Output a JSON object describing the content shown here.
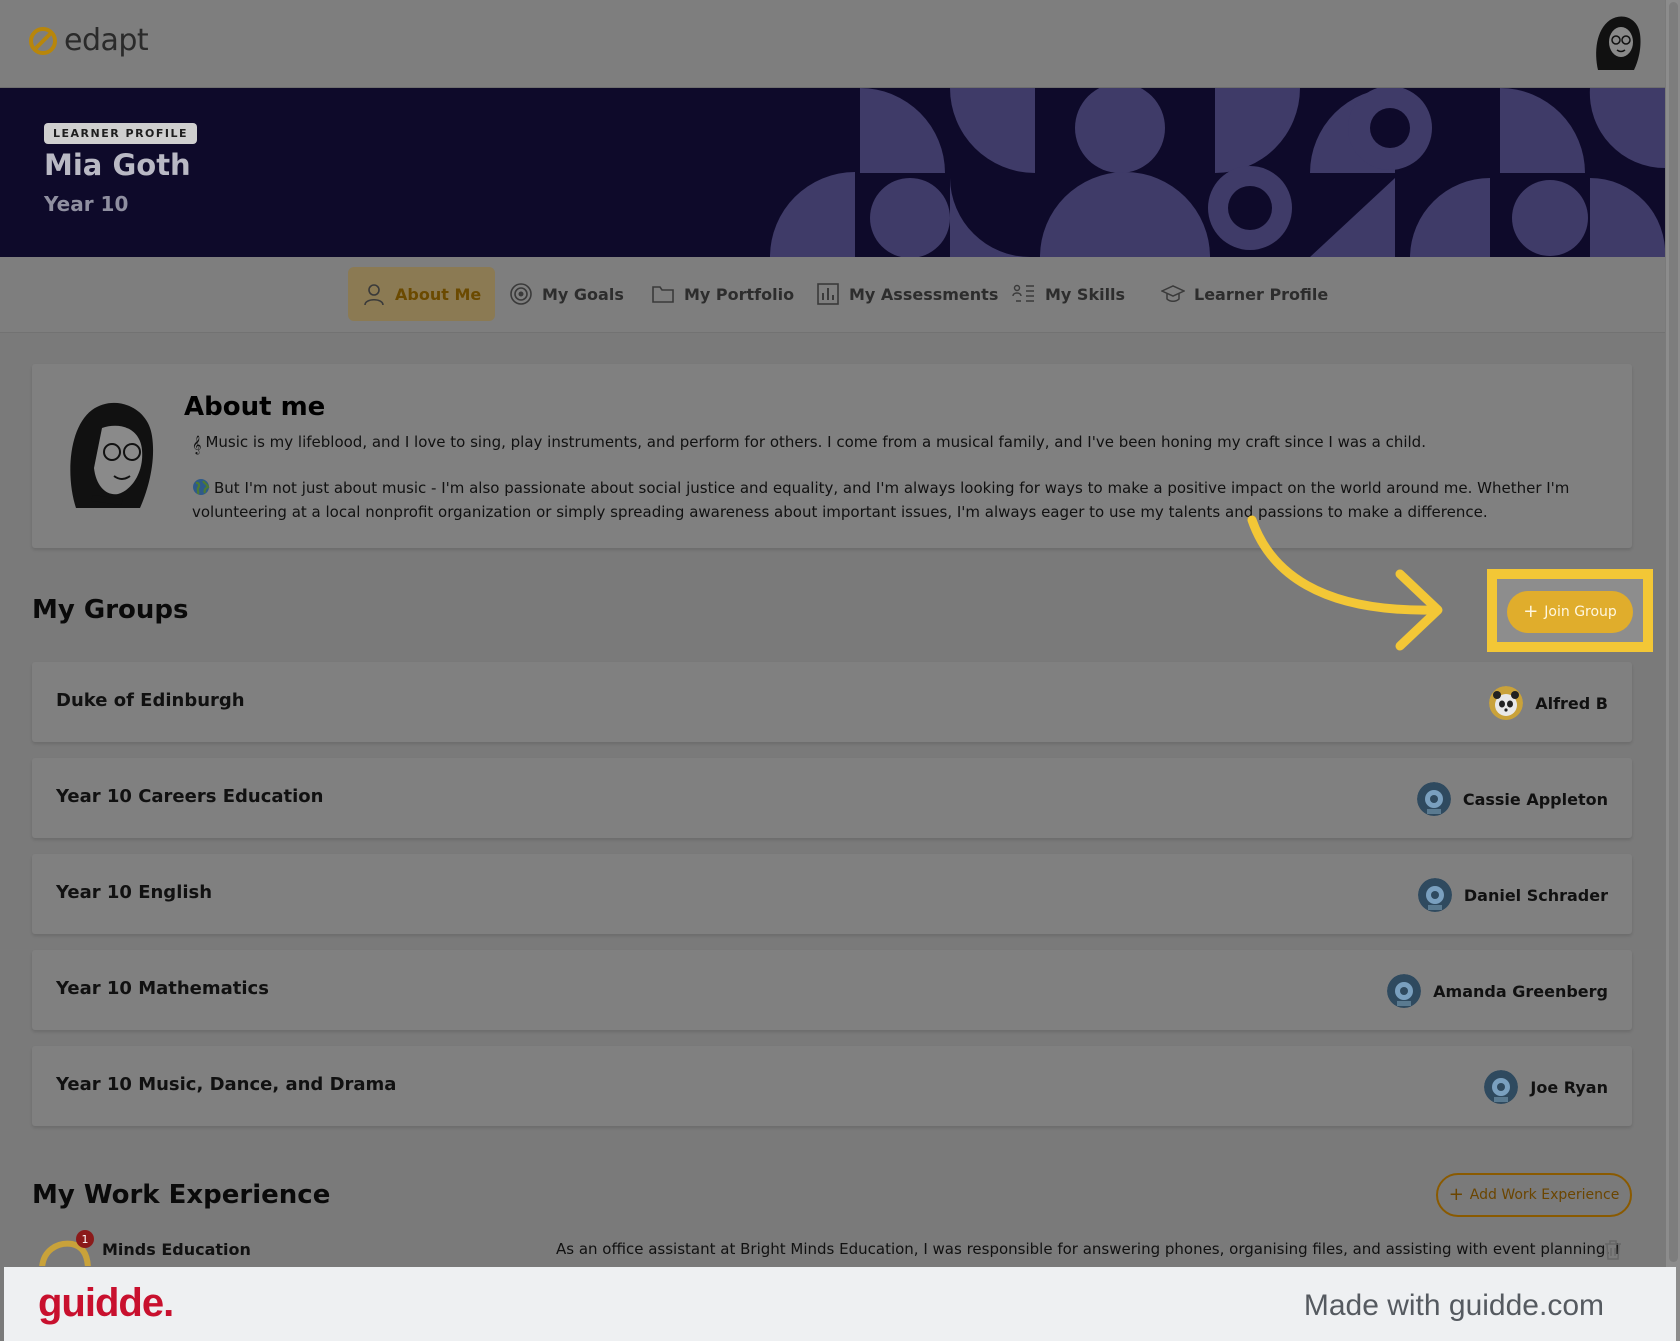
{
  "app": {
    "logo_text": "edapt"
  },
  "hero": {
    "badge": "LEARNER PROFILE",
    "name": "Mia Goth",
    "year": "Year 10"
  },
  "tabs": [
    {
      "label": "About Me",
      "icon": "user-icon",
      "active": true
    },
    {
      "label": "My Goals",
      "icon": "target-icon"
    },
    {
      "label": "My Portfolio",
      "icon": "folder-icon"
    },
    {
      "label": "My Assessments",
      "icon": "bar-chart-icon"
    },
    {
      "label": "My Skills",
      "icon": "skills-icon"
    },
    {
      "label": "Learner Profile",
      "icon": "graduation-cap-icon"
    }
  ],
  "about": {
    "title": "About me",
    "paragraph1": "Music is my lifeblood, and I love to sing, play instruments, and perform for others. I come from a musical family, and I've been honing my craft since I was a child.",
    "paragraph2": "But I'm not just about music - I'm also passionate about social justice and equality, and I'm always looking for ways to make a positive impact on the world around me. Whether I'm volunteering at a local nonprofit organization or simply spreading awareness about important issues, I'm always eager to use my talents and passions to make a difference."
  },
  "groups": {
    "title": "My Groups",
    "join_label": "Join Group",
    "items": [
      {
        "name": "Duke of Edinburgh",
        "owner": "Alfred B"
      },
      {
        "name": "Year 10 Careers Education",
        "owner": "Cassie Appleton"
      },
      {
        "name": "Year 10 English",
        "owner": "Daniel Schrader"
      },
      {
        "name": "Year 10 Mathematics",
        "owner": "Amanda Greenberg"
      },
      {
        "name": "Year 10 Music, Dance, and Drama",
        "owner": "Joe Ryan"
      }
    ]
  },
  "work": {
    "title": "My Work Experience",
    "add_label": "Add Work Experience",
    "items": [
      {
        "company": "Minds Education",
        "notification_count": "1",
        "description": "As an office assistant at Bright Minds Education, I was responsible for answering phones, organising files, and assisting with event planning. I"
      }
    ]
  },
  "footer": {
    "brand": "guidde.",
    "made_with": "Made with guidde.com"
  },
  "colors": {
    "accent": "#e0ad2c",
    "highlight": "#f3c736",
    "hero_bg": "#0e0a2a",
    "brand_red": "#c8102e"
  }
}
